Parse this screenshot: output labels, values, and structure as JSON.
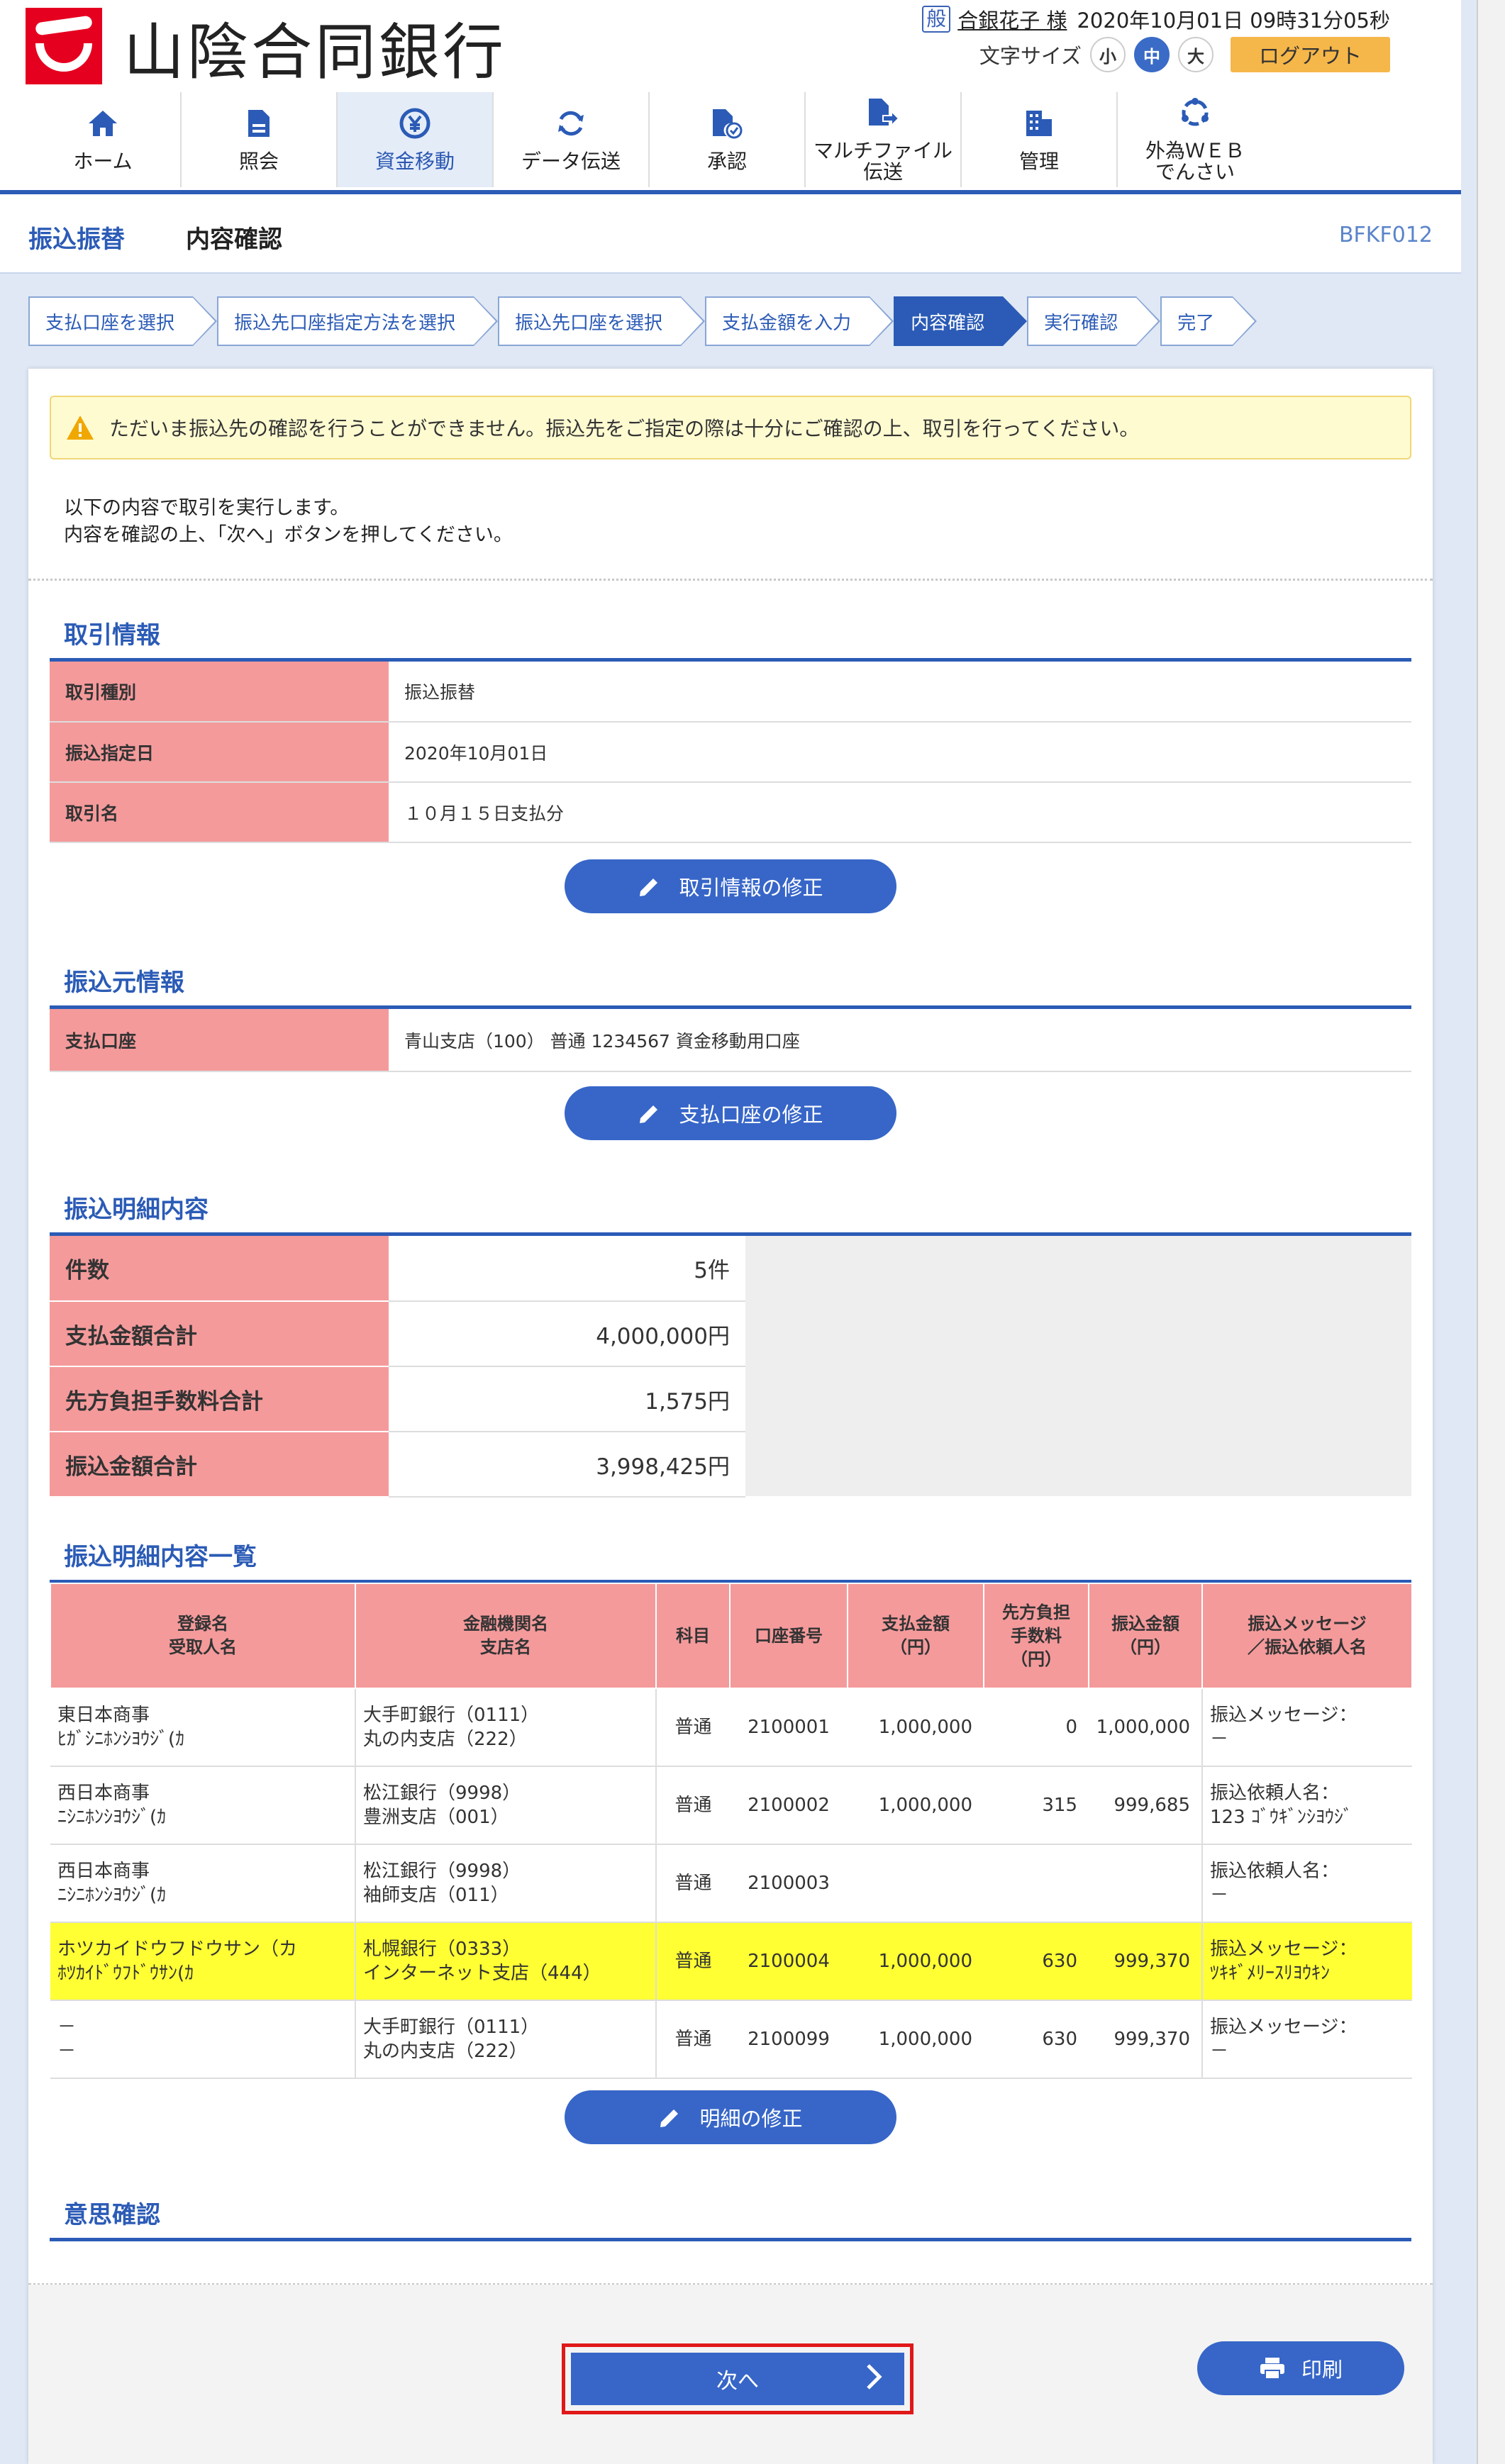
{
  "header": {
    "bank_name": "山陰合同銀行",
    "user_badge": "般",
    "user_name": "合銀花子 様",
    "datetime": "2020年10月01日 09時31分05秒",
    "font_size_label": "文字サイズ",
    "font_sizes": [
      "小",
      "中",
      "大"
    ],
    "logout_label": "ログアウト"
  },
  "nav": [
    {
      "label": "ホーム",
      "icon": "home-icon"
    },
    {
      "label": "照会",
      "icon": "document-icon"
    },
    {
      "label": "資金移動",
      "icon": "yen-transfer-icon"
    },
    {
      "label": "データ伝送",
      "icon": "refresh-icon"
    },
    {
      "label": "承認",
      "icon": "approve-icon"
    },
    {
      "label": "マルチファイル\n伝送",
      "icon": "file-send-icon"
    },
    {
      "label": "管理",
      "icon": "building-icon"
    },
    {
      "label": "外為ＷＥＢ\nでんさい",
      "icon": "cycle-icon"
    }
  ],
  "page": {
    "title": "振込振替",
    "subtitle": "内容確認",
    "code": "BFKF012"
  },
  "steps": [
    "支払口座を選択",
    "振込先口座指定方法を選択",
    "振込先口座を選択",
    "支払金額を入力",
    "内容確認",
    "実行確認",
    "完了"
  ],
  "warning": "ただいま振込先の確認を行うことができません。振込先をご指定の際は十分にご確認の上、取引を行ってください。",
  "intro": [
    "以下の内容で取引を実行します。",
    "内容を確認の上、「次へ」ボタンを押してください。"
  ],
  "torihiki": {
    "title": "取引情報",
    "rows": [
      {
        "k": "取引種別",
        "v": "振込振替"
      },
      {
        "k": "振込指定日",
        "v": "2020年10月01日"
      },
      {
        "k": "取引名",
        "v": "１０月１５日支払分"
      }
    ],
    "edit_button": "取引情報の修正"
  },
  "furikomimoto": {
    "title": "振込元情報",
    "rows": [
      {
        "k": "支払口座",
        "v": "青山支店（100） 普通 1234567 資金移動用口座"
      }
    ],
    "edit_button": "支払口座の修正"
  },
  "summary": {
    "title": "振込明細内容",
    "rows": [
      {
        "k": "件数",
        "v": "5件"
      },
      {
        "k": "支払金額合計",
        "v": "4,000,000円"
      },
      {
        "k": "先方負担手数料合計",
        "v": "1,575円"
      },
      {
        "k": "振込金額合計",
        "v": "3,998,425円"
      }
    ]
  },
  "list": {
    "title": "振込明細内容一覧",
    "headers": [
      "登録名\n受取人名",
      "金融機関名\n支店名",
      "科目",
      "口座番号",
      "支払金額\n（円）",
      "先方負担\n手数料\n（円）",
      "振込金額\n（円）",
      "振込メッセージ\n／振込依頼人名"
    ],
    "rows": [
      {
        "name": "東日本商事\nﾋｶﾞｼﾆﾎﾝｼﾖｳｼﾞ(ｶ",
        "bank": "大手町銀行（0111）\n丸の内支店（222）",
        "kamoku": "普通",
        "account": "2100001",
        "pay": "1,000,000",
        "fee": "0",
        "amount": "1,000,000",
        "msg": "振込メッセージ：\n－",
        "highlight": false
      },
      {
        "name": "西日本商事\nﾆｼﾆﾎﾝｼﾖｳｼﾞ(ｶ",
        "bank": "松江銀行（9998）\n豊洲支店（001）",
        "kamoku": "普通",
        "account": "2100002",
        "pay": "1,000,000",
        "fee": "315",
        "amount": "999,685",
        "msg": "振込依頼人名：\n123 ｺﾞｳｷﾞﾝｼﾖｳｼﾞ",
        "highlight": false
      },
      {
        "name": "西日本商事\nﾆｼﾆﾎﾝｼﾖｳｼﾞ(ｶ",
        "bank": "松江銀行（9998）\n袖師支店（011）",
        "kamoku": "普通",
        "account": "2100003",
        "pay": "",
        "fee": "",
        "amount": "",
        "msg": "振込依頼人名：\n－",
        "highlight": false
      },
      {
        "name": "ホツカイドウフドウサン（カ\nﾎﾂｶｲﾄﾞｳﾌﾄﾞｳｻﾝ(ｶ",
        "bank": "札幌銀行（0333）\nインターネット支店（444）",
        "kamoku": "普通",
        "account": "2100004",
        "pay": "1,000,000",
        "fee": "630",
        "amount": "999,370",
        "msg": "振込メッセージ：\nﾂｷｷﾞﾒﾘｰｽﾘﾖｳｷﾝ",
        "highlight": true
      },
      {
        "name": "－\n－",
        "bank": "大手町銀行（0111）\n丸の内支店（222）",
        "kamoku": "普通",
        "account": "2100099",
        "pay": "1,000,000",
        "fee": "630",
        "amount": "999,370",
        "msg": "振込メッセージ：\n－",
        "highlight": false
      }
    ],
    "edit_button": "明細の修正"
  },
  "confirm": {
    "title": "意思確認"
  },
  "actions": {
    "next": "次へ",
    "print": "印刷"
  },
  "colors": {
    "primary": "#2b5bb6",
    "button": "#3766c8",
    "label_bg": "#f49a9b",
    "highlight": "#ffff33",
    "warning_bg": "#fffbd1",
    "logout": "#f5b74a",
    "focus_border": "#e01818"
  }
}
